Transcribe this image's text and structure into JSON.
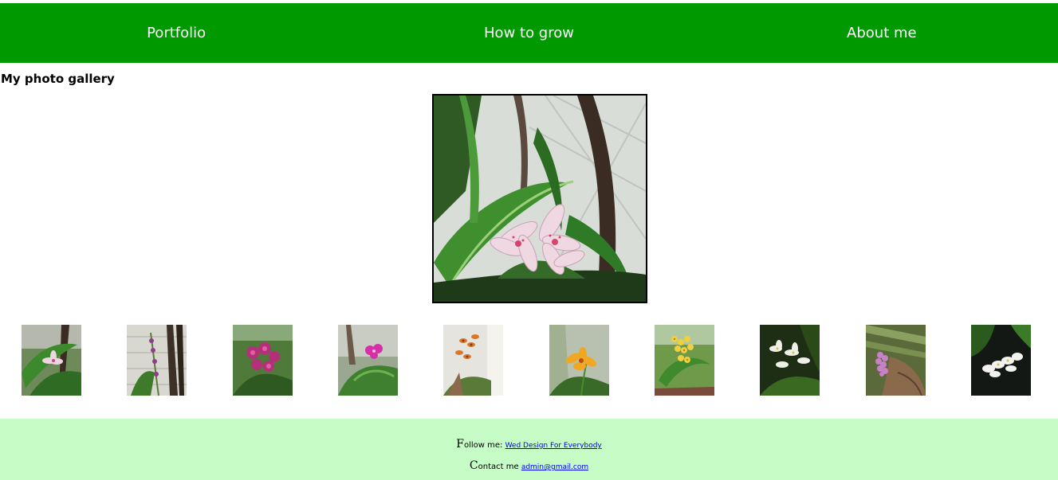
{
  "nav": {
    "items": [
      {
        "label": "Portfolio"
      },
      {
        "label": "How to grow"
      },
      {
        "label": "About me"
      }
    ],
    "bg_color": "#009900"
  },
  "gallery": {
    "heading": "My photo gallery",
    "main_photo_subject": "pink spotted orchid among green leaves",
    "thumbnails": [
      {
        "subject": "pale pink orchid in foliage"
      },
      {
        "subject": "purple orchid stems against wall"
      },
      {
        "subject": "magenta orchid cluster"
      },
      {
        "subject": "bright pink orchid"
      },
      {
        "subject": "orange spotted orchids"
      },
      {
        "subject": "yellow-orange orchid"
      },
      {
        "subject": "yellow dancing-lady orchids"
      },
      {
        "subject": "white orchids in dark foliage"
      },
      {
        "subject": "lilac orchid spike on bark"
      },
      {
        "subject": "white orchids on dark background"
      }
    ]
  },
  "footer": {
    "follow_cap": "F",
    "follow_rest": "ollow me: ",
    "follow_link": "Wed Design For Everybody",
    "contact_cap": "C",
    "contact_rest": "ontact me ",
    "contact_link": "admin@gmail.com",
    "bg_color": "#c6fcc6"
  }
}
